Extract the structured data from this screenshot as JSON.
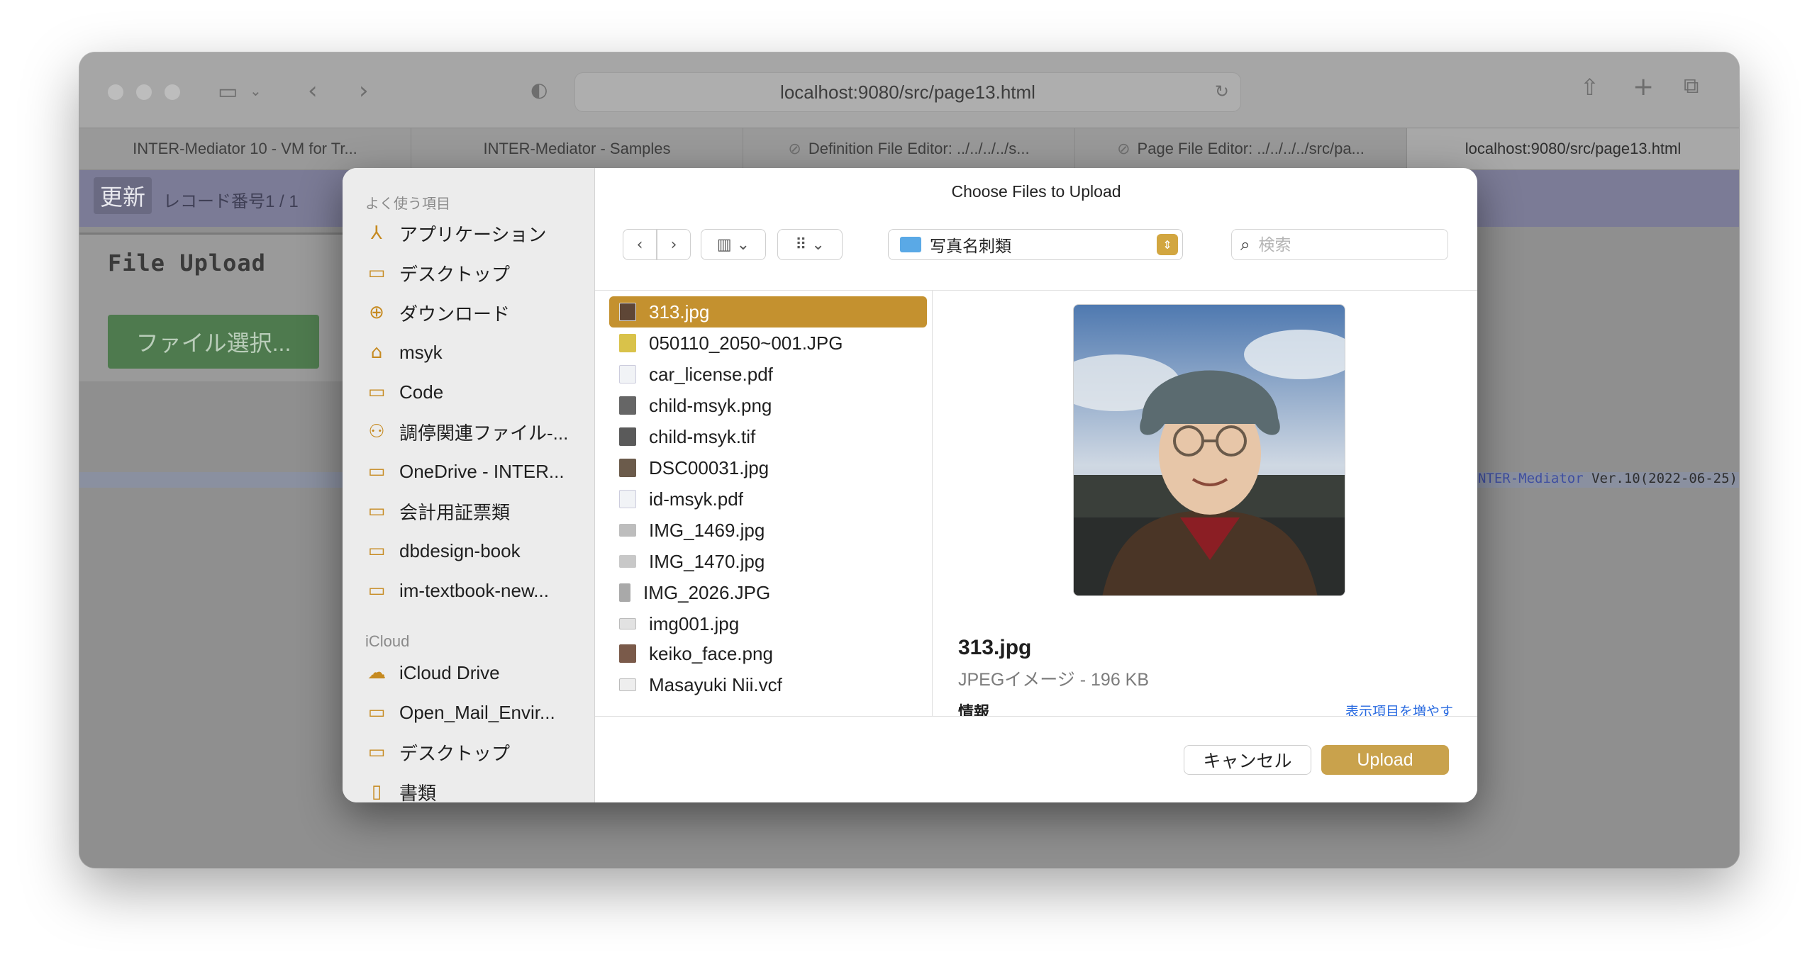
{
  "browser": {
    "url": "localhost:9080/src/page13.html",
    "tabs": [
      {
        "label": "INTER-Mediator 10 - VM for Tr..."
      },
      {
        "label": "INTER-Mediator - Samples"
      },
      {
        "label": "Definition File Editor: ../../../../s..."
      },
      {
        "label": "Page File Editor: ../../../../src/pa..."
      },
      {
        "label": "localhost:9080/src/page13.html"
      }
    ]
  },
  "page": {
    "update_label": "更新",
    "record_label": "レコード番号1 / 1",
    "title": "File Upload",
    "file_select_label": "ファイル選択...",
    "version_product": "INTER-Mediator",
    "version_text": " Ver.10(2022-06-25)"
  },
  "dialog": {
    "title": "Choose Files to Upload",
    "favorites_heading": "よく使う項目",
    "favorites": [
      {
        "label": "アプリケーション",
        "icon": "applications-icon"
      },
      {
        "label": "デスクトップ",
        "icon": "desktop-icon"
      },
      {
        "label": "ダウンロード",
        "icon": "downloads-icon"
      },
      {
        "label": "msyk",
        "icon": "home-icon"
      },
      {
        "label": "Code",
        "icon": "folder-icon"
      },
      {
        "label": "調停関連ファイル-...",
        "icon": "shared-folder-icon"
      },
      {
        "label": "OneDrive - INTER...",
        "icon": "folder-icon"
      },
      {
        "label": "会計用証票類",
        "icon": "folder-icon"
      },
      {
        "label": "dbdesign-book",
        "icon": "folder-icon"
      },
      {
        "label": "im-textbook-new...",
        "icon": "folder-icon"
      }
    ],
    "icloud_heading": "iCloud",
    "icloud": [
      {
        "label": "iCloud Drive",
        "icon": "cloud-icon"
      },
      {
        "label": "Open_Mail_Envir...",
        "icon": "folder-icon"
      },
      {
        "label": "デスクトップ",
        "icon": "desktop-icon"
      },
      {
        "label": "書類",
        "icon": "document-icon"
      }
    ],
    "current_folder": "写真名刺類",
    "search_placeholder": "検索",
    "files": [
      {
        "name": "313.jpg",
        "selected": true
      },
      {
        "name": "050110_2050~001.JPG"
      },
      {
        "name": "car_license.pdf"
      },
      {
        "name": "child-msyk.png"
      },
      {
        "name": "child-msyk.tif"
      },
      {
        "name": "DSC00031.jpg"
      },
      {
        "name": "id-msyk.pdf"
      },
      {
        "name": "IMG_1469.jpg"
      },
      {
        "name": "IMG_1470.jpg"
      },
      {
        "name": "IMG_2026.JPG"
      },
      {
        "name": "img001.jpg"
      },
      {
        "name": "keiko_face.png"
      },
      {
        "name": "Masayuki Nii.vcf"
      }
    ],
    "preview": {
      "name": "313.jpg",
      "kind": "JPEGイメージ - 196 KB",
      "info_label": "情報",
      "more_label": "表示項目を増やす"
    },
    "cancel_label": "キャンセル",
    "upload_label": "Upload"
  }
}
